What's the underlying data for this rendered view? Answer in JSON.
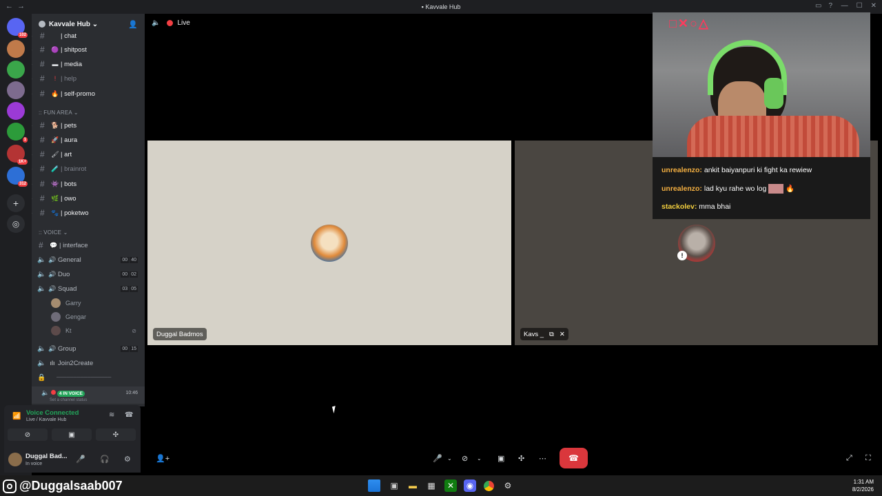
{
  "window": {
    "title": "Kavvale Hub"
  },
  "guilds": [
    {
      "badge": "102"
    },
    {
      "badge": ""
    },
    {
      "badge": ""
    },
    {
      "badge": ""
    },
    {
      "badge": ""
    },
    {
      "badge": ""
    },
    {
      "badge": "1"
    },
    {
      "badge": "1K+"
    },
    {
      "badge": "312"
    }
  ],
  "server": {
    "name": "Kavvale Hub ⌄"
  },
  "channels": {
    "text_top": [
      {
        "emoji": "",
        "name": "| chat",
        "muted": false
      },
      {
        "emoji": "🟣",
        "name": "| shitpost",
        "muted": false
      },
      {
        "emoji": "▬",
        "name": "| media",
        "muted": false
      },
      {
        "emoji": "!",
        "name": "| help",
        "muted": true
      },
      {
        "emoji": "🔥",
        "name": "| self-promo",
        "muted": false
      }
    ],
    "fun_category": "FUN AREA ⌄",
    "fun": [
      {
        "emoji": "🐕",
        "name": "| pets",
        "muted": false
      },
      {
        "emoji": "🚀",
        "name": "| aura",
        "muted": false
      },
      {
        "emoji": "🖌",
        "name": "| art",
        "muted": false
      },
      {
        "emoji": "🧪",
        "name": "| brainrot",
        "muted": true
      },
      {
        "emoji": "👾",
        "name": "| bots",
        "muted": false
      },
      {
        "emoji": "🌿",
        "name": "| owo",
        "muted": false
      },
      {
        "emoji": "🐾",
        "name": "| poketwo",
        "muted": false
      }
    ],
    "voice_category": "VOICE ⌄",
    "interface": "| interface",
    "voice": [
      {
        "name": "General",
        "c1": "00",
        "c2": "40"
      },
      {
        "name": "Duo",
        "c1": "00",
        "c2": "02"
      },
      {
        "name": "Squad",
        "c1": "03",
        "c2": "05"
      }
    ],
    "squad_users": [
      "Garry",
      "Gengar",
      "Kt"
    ],
    "group": {
      "name": "Group",
      "c1": "00",
      "c2": "15"
    },
    "join2create": "Join2Create",
    "locked": "────────────────"
  },
  "active_voice": {
    "live_label": "4 IN VOICE",
    "time": "10:46",
    "status": "Set a channel status"
  },
  "voice_panel": {
    "title": "Voice Connected",
    "subtitle": "Live / Kavvale Hub"
  },
  "user": {
    "name": "Duggal Bad...",
    "status": "In voice"
  },
  "stage": {
    "live_label": "Live"
  },
  "tiles": [
    {
      "name": "Duggal Badmos"
    },
    {
      "name": "Kavs _"
    }
  ],
  "stream_chat": [
    {
      "user": "unrealenzo:",
      "text": " ankit baiyanpuri ki fight ka rewiew",
      "yellow": false
    },
    {
      "user": "unrealenzo:",
      "text": " lad kyu rahe wo log",
      "yellow": false
    },
    {
      "user": "stackolev:",
      "text": " mma bhai",
      "yellow": true
    }
  ],
  "watermark": "@Duggalsaab007",
  "clock": {
    "time": "1:31 AM",
    "date": "8/2/2026"
  },
  "colors": {
    "accent": "#5865f2",
    "green": "#23a55a",
    "red": "#da373c",
    "live": "#f23f43"
  }
}
